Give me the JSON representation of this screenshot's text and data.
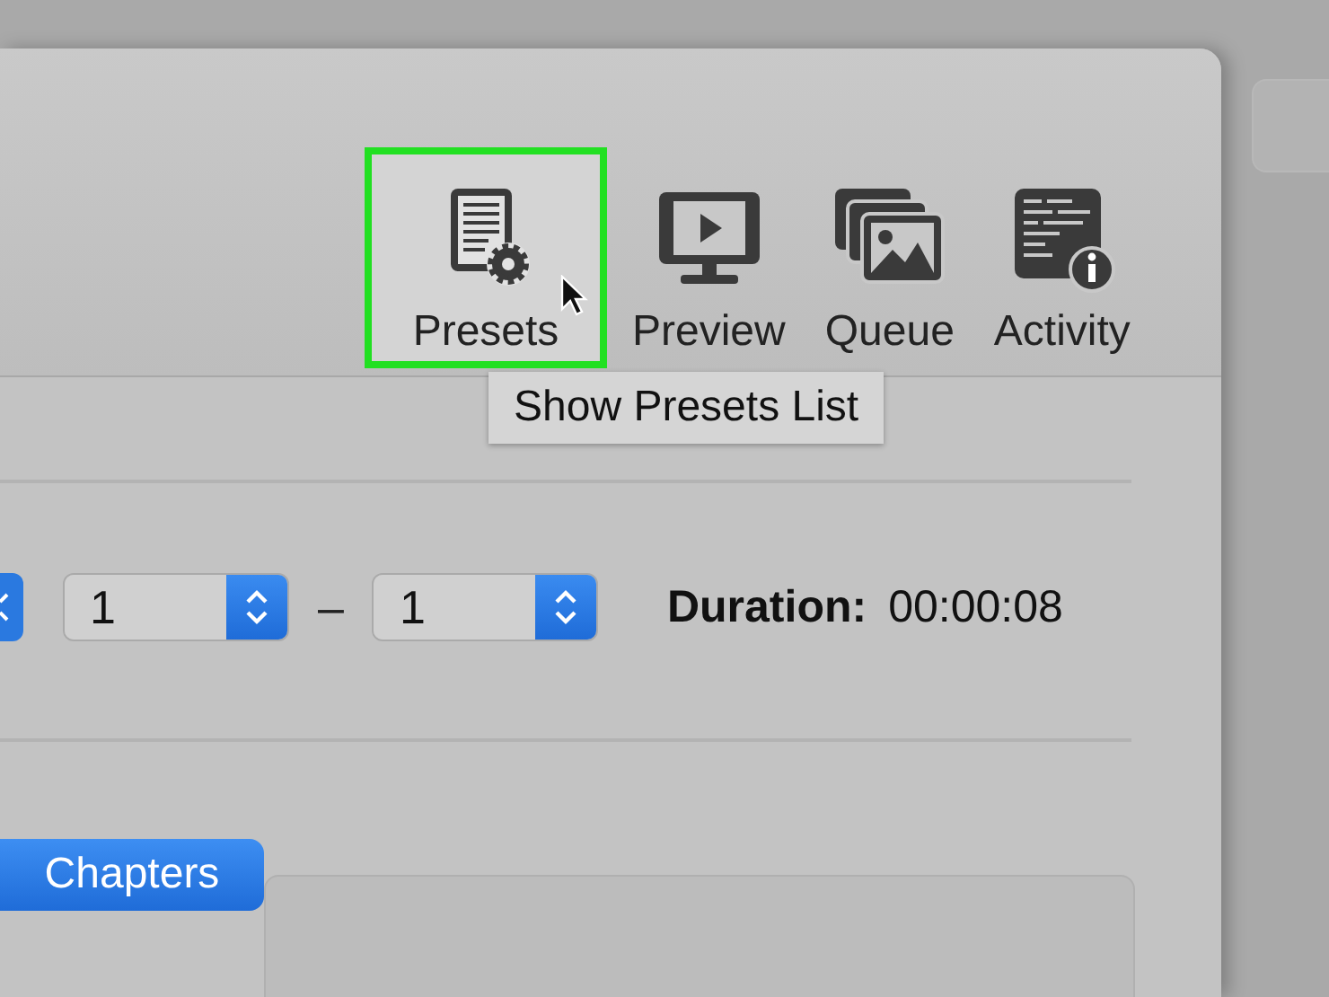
{
  "toolbar": {
    "items": [
      {
        "kind": "presets",
        "label": "Presets",
        "selected": true
      },
      {
        "kind": "preview",
        "label": "Preview",
        "selected": false
      },
      {
        "kind": "queue",
        "label": "Queue",
        "selected": false
      },
      {
        "kind": "activity",
        "label": "Activity",
        "selected": false
      }
    ]
  },
  "tooltip": "Show Presets List",
  "range": {
    "start": "1",
    "separator": "–",
    "end": "1"
  },
  "duration": {
    "label": "Duration:",
    "value": "00:00:08"
  },
  "tabs": [
    {
      "label": "Chapters",
      "selected": true
    }
  ]
}
